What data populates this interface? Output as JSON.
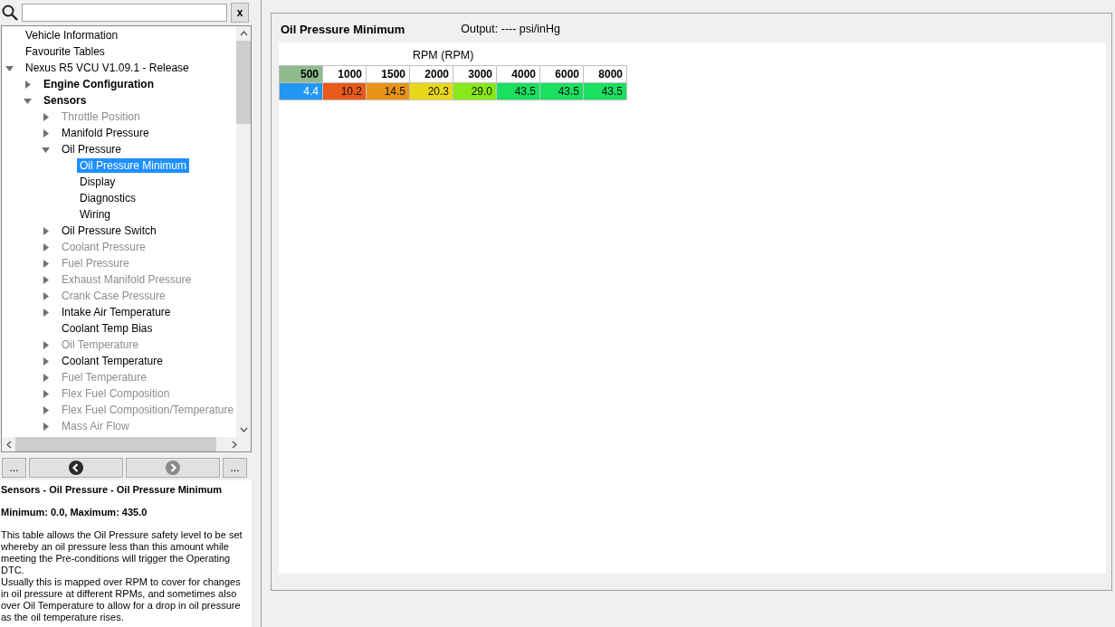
{
  "search": {
    "clear_label": "x"
  },
  "tree": [
    {
      "label": "Vehicle Information",
      "kind": "item",
      "disabled": false,
      "selected": false
    },
    {
      "label": "Favourite Tables",
      "kind": "item",
      "disabled": false,
      "selected": false
    },
    {
      "label": "Nexus R5 VCU V1.09.1 - Release",
      "kind": "item",
      "disabled": false,
      "selected": false,
      "expanded": true,
      "children": [
        {
          "label": "Engine Configuration",
          "kind": "section",
          "disabled": false,
          "selected": false,
          "expanded": false
        },
        {
          "label": "Sensors",
          "kind": "section",
          "disabled": false,
          "selected": false,
          "expanded": true,
          "children": [
            {
              "label": "Throttle Position",
              "kind": "item",
              "disabled": true,
              "selected": false,
              "expanded": false
            },
            {
              "label": "Manifold Pressure",
              "kind": "item",
              "disabled": false,
              "selected": false,
              "expanded": false
            },
            {
              "label": "Oil Pressure",
              "kind": "item",
              "disabled": false,
              "selected": false,
              "expanded": true,
              "children": [
                {
                  "label": "Oil Pressure Minimum",
                  "kind": "item",
                  "disabled": false,
                  "selected": true
                },
                {
                  "label": "Display",
                  "kind": "item",
                  "disabled": false,
                  "selected": false
                },
                {
                  "label": "Diagnostics",
                  "kind": "item",
                  "disabled": false,
                  "selected": false
                },
                {
                  "label": "Wiring",
                  "kind": "item",
                  "disabled": false,
                  "selected": false
                }
              ]
            },
            {
              "label": "Oil Pressure Switch",
              "kind": "item",
              "disabled": false,
              "selected": false,
              "expanded": false
            },
            {
              "label": "Coolant Pressure",
              "kind": "item",
              "disabled": true,
              "selected": false,
              "expanded": false
            },
            {
              "label": "Fuel Pressure",
              "kind": "item",
              "disabled": true,
              "selected": false,
              "expanded": false
            },
            {
              "label": "Exhaust Manifold Pressure",
              "kind": "item",
              "disabled": true,
              "selected": false,
              "expanded": false
            },
            {
              "label": "Crank Case Pressure",
              "kind": "item",
              "disabled": true,
              "selected": false,
              "expanded": false
            },
            {
              "label": "Intake Air Temperature",
              "kind": "item",
              "disabled": false,
              "selected": false,
              "expanded": false
            },
            {
              "label": "Coolant Temp Bias",
              "kind": "item",
              "disabled": false,
              "selected": false
            },
            {
              "label": "Oil Temperature",
              "kind": "item",
              "disabled": true,
              "selected": false,
              "expanded": false
            },
            {
              "label": "Coolant Temperature",
              "kind": "item",
              "disabled": false,
              "selected": false,
              "expanded": false
            },
            {
              "label": "Fuel Temperature",
              "kind": "item",
              "disabled": true,
              "selected": false,
              "expanded": false
            },
            {
              "label": "Flex Fuel Composition",
              "kind": "item",
              "disabled": true,
              "selected": false,
              "expanded": false
            },
            {
              "label": "Flex Fuel Composition/Temperature",
              "kind": "item",
              "disabled": true,
              "selected": false,
              "expanded": false
            },
            {
              "label": "Mass Air Flow",
              "kind": "item",
              "disabled": true,
              "selected": false,
              "expanded": false
            }
          ]
        }
      ]
    }
  ],
  "nav_buttons": [
    {
      "kind": "more",
      "label": "..."
    },
    {
      "kind": "back",
      "disabled": false
    },
    {
      "kind": "forward",
      "disabled": true
    },
    {
      "kind": "more",
      "label": "..."
    }
  ],
  "description": {
    "path": "Sensors - Oil Pressure - Oil Pressure Minimum",
    "range": "Minimum: 0.0, Maximum: 435.0",
    "paragraphs": [
      "This table allows the Oil Pressure safety level to be set whereby an oil pressure less than this amount while meeting the Pre-conditions will trigger the Operating DTC.",
      "Usually this is mapped over RPM to cover for changes in oil pressure at different RPMs, and sometimes also over Oil Temperature to allow for a drop in oil pressure as the oil temperature rises."
    ]
  },
  "table_panel": {
    "title": "Oil Pressure Minimum",
    "output": "Output: ---- psi/inHg",
    "axis_label": "RPM (RPM)",
    "columns": [
      {
        "label": "500",
        "selected": true
      },
      {
        "label": "1000",
        "selected": false
      },
      {
        "label": "1500",
        "selected": false
      },
      {
        "label": "2000",
        "selected": false
      },
      {
        "label": "3000",
        "selected": false
      },
      {
        "label": "4000",
        "selected": false
      },
      {
        "label": "6000",
        "selected": false
      },
      {
        "label": "8000",
        "selected": false
      }
    ],
    "cells": [
      {
        "value": "4.4",
        "color": "#2196f3",
        "selected": true
      },
      {
        "value": "10.2",
        "color": "#e85a1a",
        "selected": false
      },
      {
        "value": "14.5",
        "color": "#e8941a",
        "selected": false
      },
      {
        "value": "20.3",
        "color": "#e8d81a",
        "selected": false
      },
      {
        "value": "29.0",
        "color": "#88e81a",
        "selected": false
      },
      {
        "value": "43.5",
        "color": "#1ae060",
        "selected": false
      },
      {
        "value": "43.5",
        "color": "#1ae060",
        "selected": false
      },
      {
        "value": "43.5",
        "color": "#1ae060",
        "selected": false
      }
    ]
  }
}
